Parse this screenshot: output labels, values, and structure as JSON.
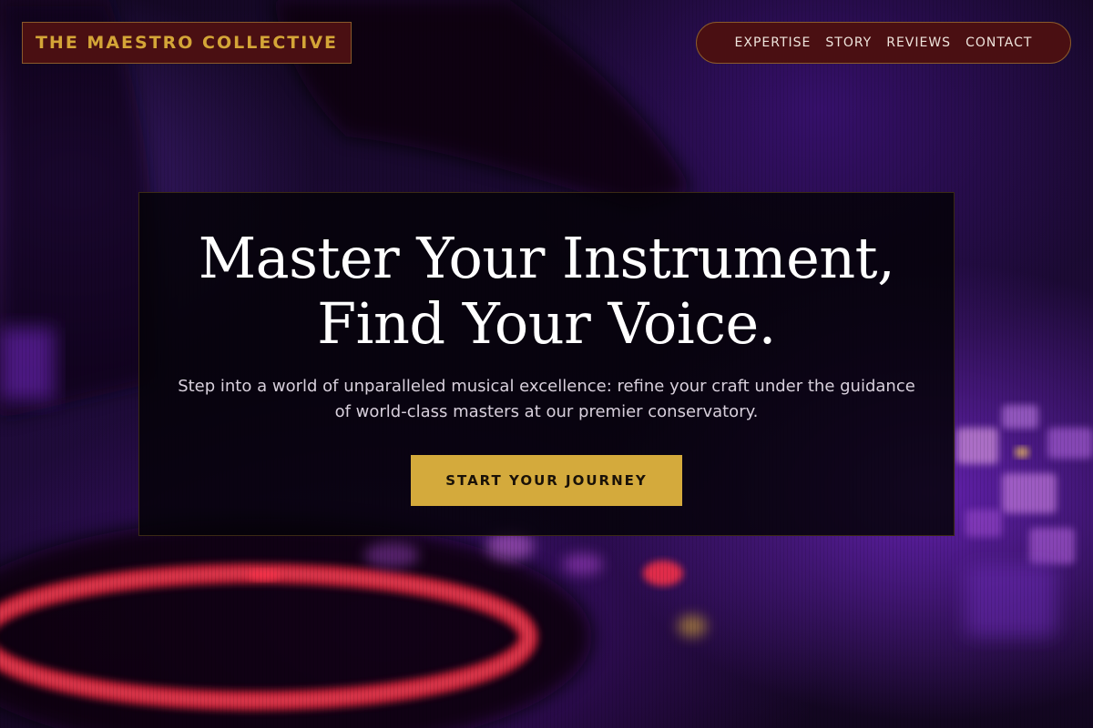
{
  "brand": {
    "name": "THE MAESTRO COLLECTIVE"
  },
  "nav": {
    "items": [
      {
        "label": "EXPERTISE"
      },
      {
        "label": "STORY"
      },
      {
        "label": "REVIEWS"
      },
      {
        "label": "CONTACT"
      }
    ]
  },
  "hero": {
    "title_line1": "Master Your Instrument,",
    "title_line2": "Find Your Voice.",
    "subtitle": "Step into a world of unparalleled musical excellence: refine your craft under the guidance of world-class masters at our premier conservatory.",
    "cta_label": "START YOUR JOURNEY"
  },
  "colors": {
    "accent_gold": "#d4aa3c",
    "header_bg": "#4a0f12",
    "background_purple": "#200b3c",
    "neon_red": "#e0263c"
  }
}
